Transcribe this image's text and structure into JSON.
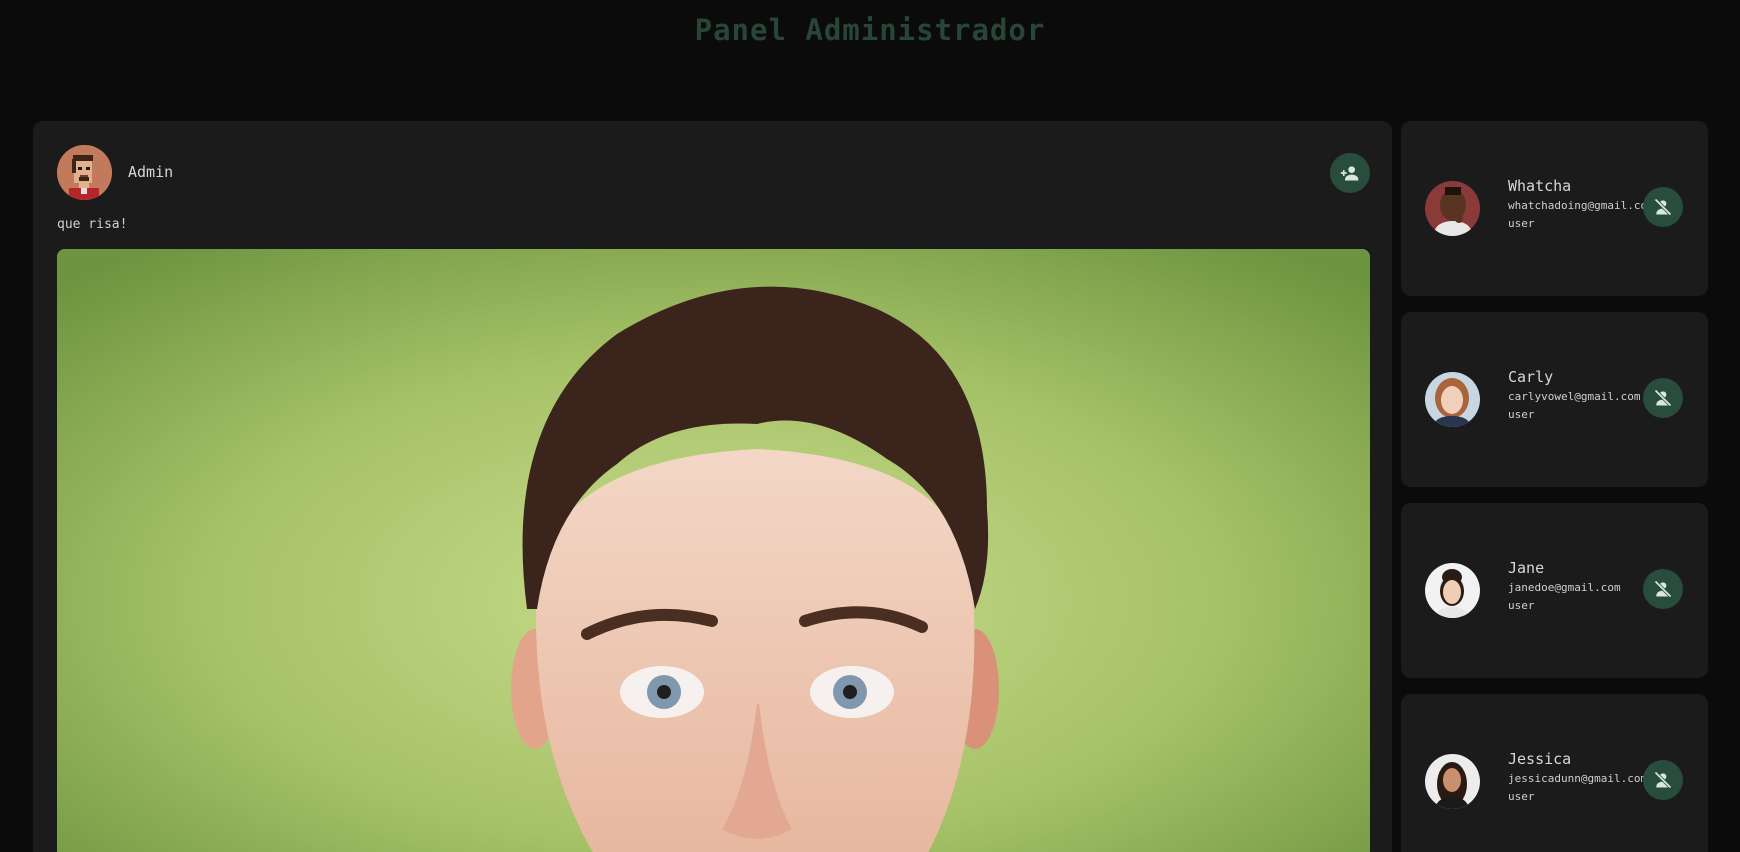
{
  "header": {
    "title": "Panel Administrador"
  },
  "post": {
    "author": "Admin",
    "text": "que risa!"
  },
  "users": [
    {
      "name": "Whatcha",
      "email": "whatchadoing@gmail.com",
      "role": "user"
    },
    {
      "name": "Carly",
      "email": "carlyvowel@gmail.com",
      "role": "user"
    },
    {
      "name": "Jane",
      "email": "janedoe@gmail.com",
      "role": "user"
    },
    {
      "name": "Jessica",
      "email": "jessicadunn@gmail.com",
      "role": "user"
    }
  ],
  "colors": {
    "background": "#0b0b0b",
    "card": "#1b1b1b",
    "accent": "#284d3c",
    "title": "#274636"
  },
  "icons": {
    "add_user": "person-add-icon",
    "remove_user": "person-off-icon"
  }
}
